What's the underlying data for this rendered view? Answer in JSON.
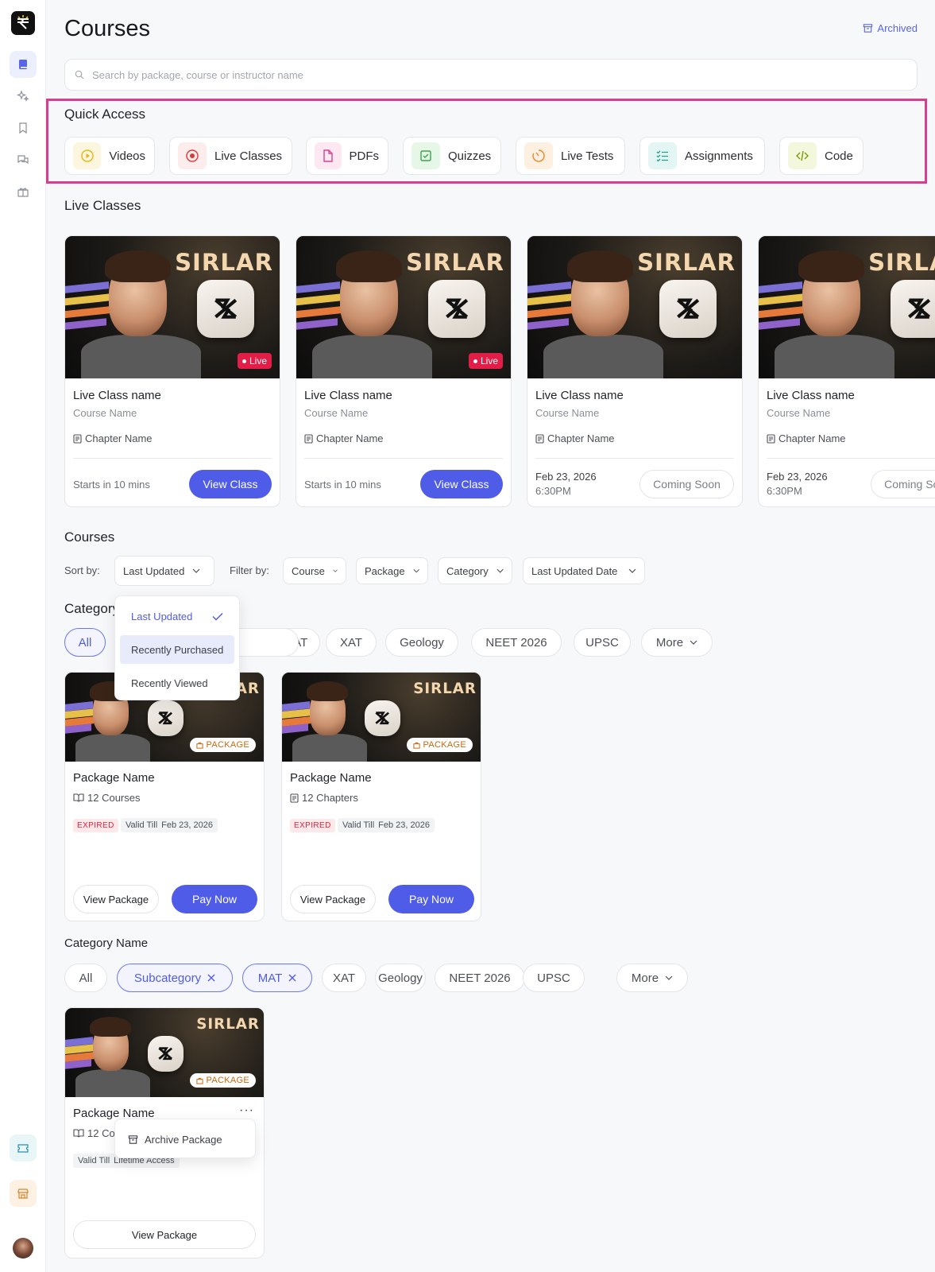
{
  "header": {
    "title": "Courses",
    "archived_label": "Archived",
    "search_placeholder": "Search by package, course or instructor name"
  },
  "quick_access": {
    "title": "Quick Access",
    "items": [
      {
        "label": "Videos",
        "icon": "play-circle-icon",
        "color": "#e7b416",
        "bg": "#fdf6df"
      },
      {
        "label": "Live Classes",
        "icon": "record-icon",
        "color": "#d93a3a",
        "bg": "#fdecec"
      },
      {
        "label": "PDFs",
        "icon": "file-icon",
        "color": "#d9418f",
        "bg": "#fde8f2"
      },
      {
        "label": "Quizzes",
        "icon": "check-square-icon",
        "color": "#3aa54b",
        "bg": "#e6f6e7"
      },
      {
        "label": "Live Tests",
        "icon": "timer-icon",
        "color": "#e5892a",
        "bg": "#fdf0e1"
      },
      {
        "label": "Assignments",
        "icon": "list-check-icon",
        "color": "#1fa28f",
        "bg": "#e3f6f3"
      },
      {
        "label": "Code",
        "icon": "code-icon",
        "color": "#7a9a0a",
        "bg": "#f3f7dc"
      }
    ]
  },
  "live_classes": {
    "title": "Live Classes",
    "cards": [
      {
        "brand": "SIRLAR",
        "badge": "Live",
        "name": "Live Class name",
        "course": "Course Name",
        "chapter": "Chapter Name",
        "time_line1": "Starts in 10 mins",
        "time_line2": "",
        "button": "View Class",
        "button_style": "primary"
      },
      {
        "brand": "SIRLAR",
        "badge": "Live",
        "name": "Live Class name",
        "course": "Course Name",
        "chapter": "Chapter Name",
        "time_line1": "Starts in 10 mins",
        "time_line2": "",
        "button": "View Class",
        "button_style": "primary"
      },
      {
        "brand": "SIRLAR",
        "badge": "",
        "name": "Live Class name",
        "course": "Course Name",
        "chapter": "Chapter Name",
        "time_line1": "Feb 23, 2026",
        "time_line2": "6:30PM",
        "button": "Coming Soon",
        "button_style": "outline"
      },
      {
        "brand": "SIRLAR",
        "badge": "",
        "name": "Live Class name",
        "course": "Course Name",
        "chapter": "Chapter Name",
        "time_line1": "Feb 23, 2026",
        "time_line2": "6:30PM",
        "button": "Coming Soon",
        "button_style": "outline"
      }
    ]
  },
  "courses": {
    "title": "Courses",
    "sort_label": "Sort by:",
    "sort_value": "Last Updated",
    "filter_label": "Filter by:",
    "filters": [
      "Course",
      "Package",
      "Category",
      "Last Updated Date"
    ],
    "sort_menu": [
      {
        "label": "Last Updated",
        "state": "selected"
      },
      {
        "label": "Recently Purchased",
        "state": "hover"
      },
      {
        "label": "Recently Viewed",
        "state": "normal"
      }
    ]
  },
  "category1": {
    "title": "Category",
    "chips": [
      "All",
      "",
      "MAT",
      "XAT",
      "Geology",
      "NEET 2026",
      "UPSC",
      "More"
    ],
    "packages": [
      {
        "brand": "SIRLAR",
        "badge": "PACKAGE",
        "name": "Package Name",
        "count": "12 Courses",
        "count_icon": "book-open-icon",
        "status": "EXPIRED",
        "valid_label": "Valid Till",
        "valid_value": "Feb 23, 2026",
        "btn_secondary": "View Package",
        "btn_primary": "Pay Now"
      },
      {
        "brand": "SIRLAR",
        "badge": "PACKAGE",
        "name": "Package Name",
        "count": "12 Chapters",
        "count_icon": "book-icon",
        "status": "EXPIRED",
        "valid_label": "Valid Till",
        "valid_value": "Feb 23, 2026",
        "btn_secondary": "View Package",
        "btn_primary": "Pay Now"
      }
    ]
  },
  "category2": {
    "title": "Category Name",
    "chips": [
      {
        "label": "All",
        "selected": false
      },
      {
        "label": "Subcategory",
        "selected": true
      },
      {
        "label": "MAT",
        "selected": true
      },
      {
        "label": "XAT",
        "selected": false
      },
      {
        "label": "Geology",
        "selected": false
      },
      {
        "label": "NEET 2026",
        "selected": false
      },
      {
        "label": "UPSC",
        "selected": false
      },
      {
        "label": "More",
        "selected": false
      }
    ],
    "package": {
      "brand": "SIRLAR",
      "badge": "PACKAGE",
      "name": "Package Name",
      "count": "12 Co",
      "valid_label": "Valid Till",
      "valid_value": "Lifetime Access",
      "btn": "View Package",
      "menu_item": "Archive Package"
    }
  },
  "colors": {
    "accent": "#4f5ce8",
    "highlight_border": "#d4408f"
  }
}
